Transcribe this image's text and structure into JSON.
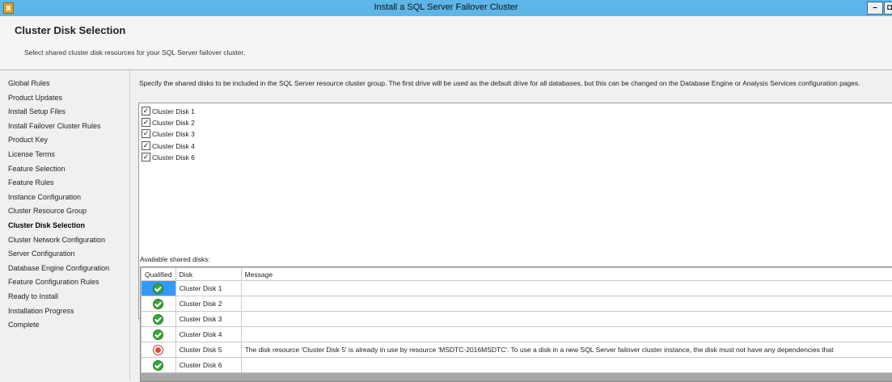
{
  "window": {
    "title": "Install a SQL Server Failover Cluster",
    "minimize_glyph": "–",
    "maximize_glyph": "◘"
  },
  "header": {
    "title": "Cluster Disk Selection",
    "subtitle": "Select shared cluster disk resources for your SQL Server failover cluster."
  },
  "sidebar": {
    "items": [
      {
        "label": "Global Rules"
      },
      {
        "label": "Product Updates"
      },
      {
        "label": "Install Setup Files"
      },
      {
        "label": "Install Failover Cluster Rules"
      },
      {
        "label": "Product Key"
      },
      {
        "label": "License Terms"
      },
      {
        "label": "Feature Selection"
      },
      {
        "label": "Feature Rules"
      },
      {
        "label": "Instance Configuration"
      },
      {
        "label": "Cluster Resource Group"
      },
      {
        "label": "Cluster Disk Selection",
        "active": true
      },
      {
        "label": "Cluster Network Configuration"
      },
      {
        "label": "Server Configuration"
      },
      {
        "label": "Database Engine Configuration"
      },
      {
        "label": "Feature Configuration Rules"
      },
      {
        "label": "Ready to Install"
      },
      {
        "label": "Installation Progress"
      },
      {
        "label": "Complete"
      }
    ]
  },
  "main": {
    "instructions": "Specify the shared disks to be included in the SQL Server resource cluster group. The first drive will be used as the default drive for all databases, but this can be changed on the Database Engine or Analysis Services configuration pages.",
    "selected_disks": [
      {
        "label": "Cluster Disk 1",
        "checked": true
      },
      {
        "label": "Cluster Disk 2",
        "checked": true
      },
      {
        "label": "Cluster Disk 3",
        "checked": true
      },
      {
        "label": "Cluster Disk 4",
        "checked": true
      },
      {
        "label": "Cluster Disk 6",
        "checked": true
      }
    ],
    "available_label": "Available shared disks:",
    "table": {
      "headers": {
        "qualified": "Qualified",
        "disk": "Disk",
        "message": "Message"
      },
      "rows": [
        {
          "status": "ok",
          "disk": "Cluster Disk 1",
          "message": "",
          "selected": true
        },
        {
          "status": "ok",
          "disk": "Cluster Disk 2",
          "message": ""
        },
        {
          "status": "ok",
          "disk": "Cluster Disk 3",
          "message": ""
        },
        {
          "status": "ok",
          "disk": "Cluster Disk 4",
          "message": ""
        },
        {
          "status": "error",
          "disk": "Cluster Disk 5",
          "message": "The disk resource 'Cluster Disk 5' is already in use by resource 'MSDTC-2016MSDTC'. To use a disk in a new SQL Server failover cluster instance, the disk must not have any dependencies that"
        },
        {
          "status": "ok",
          "disk": "Cluster Disk 6",
          "message": ""
        }
      ]
    }
  },
  "colors": {
    "titlebar": "#5db6e8",
    "selection": "#3399ff",
    "ok": "#3aa53a",
    "error": "#e04a3a"
  }
}
